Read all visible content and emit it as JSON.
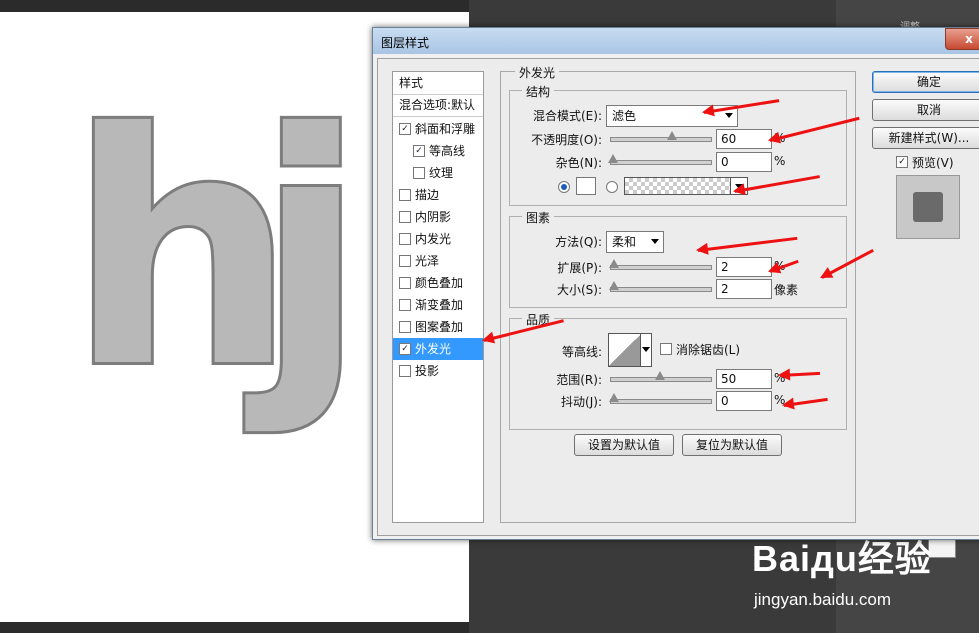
{
  "canvas": {
    "letters": [
      "h",
      "j"
    ]
  },
  "ps_panel": {
    "label": "调整"
  },
  "watermark": {
    "logo": "Baiдu经验",
    "url": "jingyan.baidu.com"
  },
  "dialog": {
    "title": "图层样式",
    "close": "x",
    "styles_list": {
      "header": "样式",
      "blend": "混合选项:默认",
      "items": [
        {
          "label": "斜面和浮雕",
          "checked": true
        },
        {
          "label": "等高线",
          "checked": true,
          "sub": true
        },
        {
          "label": "纹理",
          "checked": false,
          "sub": true
        },
        {
          "label": "描边",
          "checked": false
        },
        {
          "label": "内阴影",
          "checked": false
        },
        {
          "label": "内发光",
          "checked": false
        },
        {
          "label": "光泽",
          "checked": false
        },
        {
          "label": "颜色叠加",
          "checked": false
        },
        {
          "label": "渐变叠加",
          "checked": false
        },
        {
          "label": "图案叠加",
          "checked": false
        },
        {
          "label": "外发光",
          "checked": true,
          "selected": true
        },
        {
          "label": "投影",
          "checked": false
        }
      ]
    },
    "outer_glow": {
      "title": "外发光",
      "structure": {
        "title": "结构",
        "blend_mode_label": "混合模式(E):",
        "blend_mode_value": "滤色",
        "opacity_label": "不透明度(O):",
        "opacity_value": "60",
        "opacity_unit": "%",
        "noise_label": "杂色(N):",
        "noise_value": "0",
        "noise_unit": "%"
      },
      "elements": {
        "title": "图素",
        "method_label": "方法(Q):",
        "method_value": "柔和",
        "spread_label": "扩展(P):",
        "spread_value": "2",
        "spread_unit": "%",
        "size_label": "大小(S):",
        "size_value": "2",
        "size_unit": "像素"
      },
      "quality": {
        "title": "品质",
        "contour_label": "等高线:",
        "antialias_label": "消除锯齿(L)",
        "range_label": "范围(R):",
        "range_value": "50",
        "range_unit": "%",
        "jitter_label": "抖动(J):",
        "jitter_value": "0",
        "jitter_unit": "%"
      },
      "set_default": "设置为默认值",
      "reset_default": "复位为默认值"
    },
    "buttons": {
      "ok": "确定",
      "cancel": "取消",
      "new_style": "新建样式(W)...",
      "preview_label": "预览(V)"
    }
  }
}
